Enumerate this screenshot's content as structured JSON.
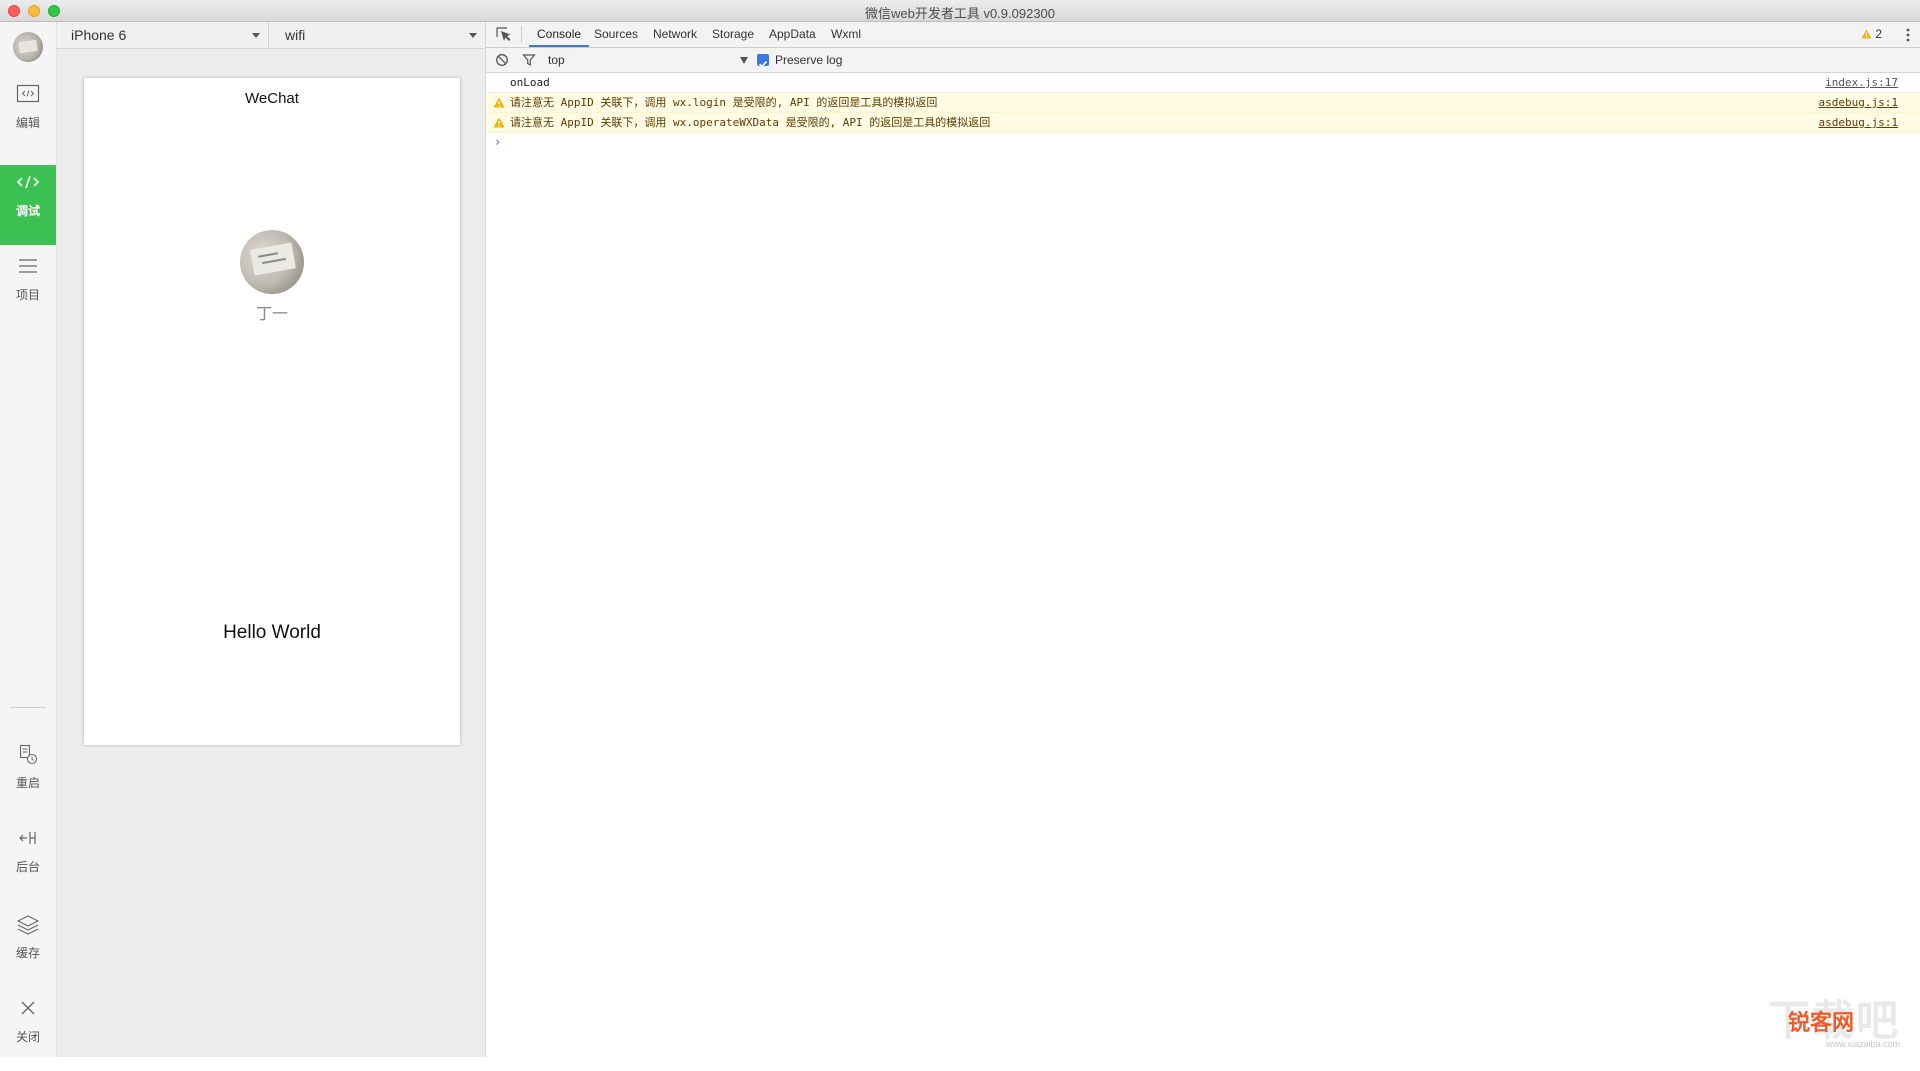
{
  "window": {
    "title": "微信web开发者工具 v0.9.092300"
  },
  "sidebar": {
    "items": [
      {
        "label": "编辑",
        "icon": "code-window-icon",
        "active": false
      },
      {
        "label": "调试",
        "icon": "code-brackets-icon",
        "active": true
      },
      {
        "label": "项目",
        "icon": "list-icon",
        "active": false
      },
      {
        "label": "重启",
        "icon": "restart-icon",
        "active": false
      },
      {
        "label": "后台",
        "icon": "background-icon",
        "active": false
      },
      {
        "label": "缓存",
        "icon": "layers-icon",
        "active": false
      },
      {
        "label": "关闭",
        "icon": "close-icon",
        "active": false
      }
    ],
    "active_color": "#3cc051"
  },
  "simulator": {
    "device": "iPhone 6",
    "network": "wifi",
    "nav_title": "WeChat",
    "nickname": "丁一",
    "hello_text": "Hello World"
  },
  "devtools": {
    "tabs": [
      "Console",
      "Sources",
      "Network",
      "Storage",
      "AppData",
      "Wxml"
    ],
    "active_tab": "Console",
    "warning_count": "2",
    "context": "top",
    "preserve_log": "Preserve log",
    "preserve_log_checked": true,
    "logs": [
      {
        "level": "log",
        "message": "onLoad",
        "source": "index.js:17"
      },
      {
        "level": "warning",
        "message": "请注意无 AppID 关联下，调用 wx.login 是受限的, API 的返回是工具的模拟返回",
        "source": "asdebug.js:1"
      },
      {
        "level": "warning",
        "message": "请注意无 AppID 关联下，调用 wx.operateWXData 是受限的, API 的返回是工具的模拟返回",
        "source": "asdebug.js:1"
      }
    ],
    "accent_color": "#3879d9"
  },
  "watermark": {
    "brand": "锐客网",
    "url": "www.xiazaiba.com"
  }
}
